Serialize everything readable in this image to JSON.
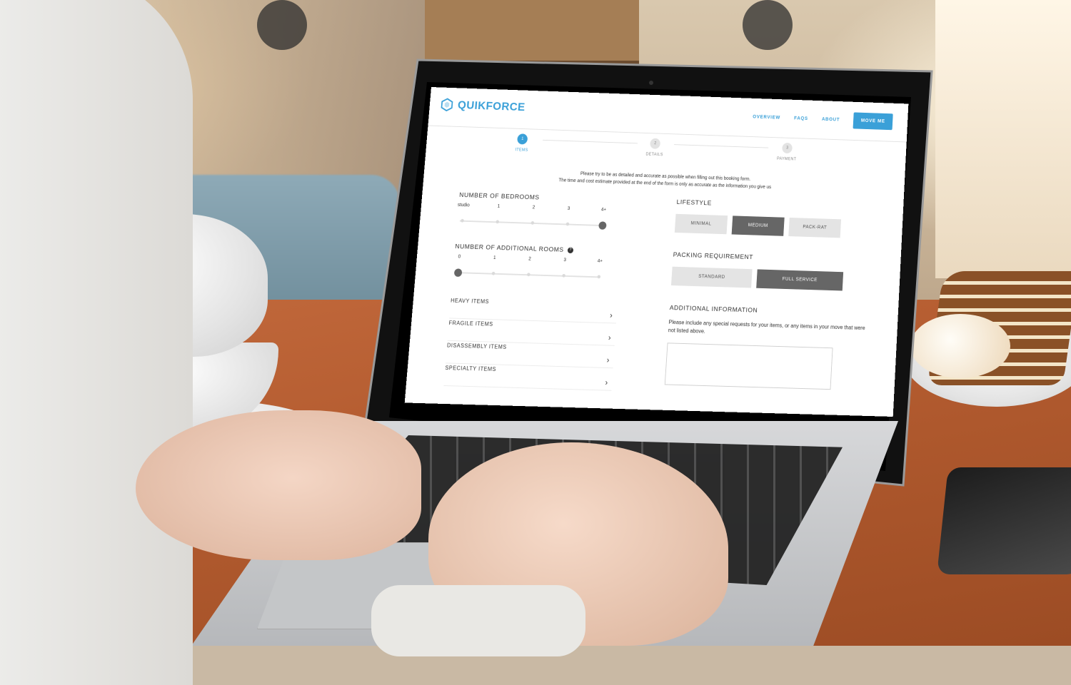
{
  "app": {
    "brand": "QUIKFORCE",
    "brand_color": "#3aa0d8",
    "logo_icon": "hexagon-icon"
  },
  "nav": {
    "links": [
      "OVERVIEW",
      "FAQS",
      "ABOUT"
    ],
    "cta": "MOVE ME"
  },
  "steps": [
    {
      "number": "1",
      "label": "ITEMS",
      "active": true
    },
    {
      "number": "2",
      "label": "DETAILS",
      "active": false
    },
    {
      "number": "3",
      "label": "PAYMENT",
      "active": false
    }
  ],
  "intro": {
    "line1": "Please try to be as detailed and accurate as possible when filling out this booking form.",
    "line2": "The time and cost estimate provided at the end of the form is only as accurate as the information you give us"
  },
  "bedrooms": {
    "title": "NUMBER OF BEDROOMS",
    "ticks": [
      "studio",
      "1",
      "2",
      "3",
      "4+"
    ],
    "selected": "4+"
  },
  "additional_rooms": {
    "title": "NUMBER OF ADDITIONAL ROOMS",
    "help_icon": "question-icon",
    "help_glyph": "?",
    "ticks": [
      "0",
      "1",
      "2",
      "3",
      "4+"
    ],
    "selected": "0"
  },
  "item_categories": [
    {
      "label": "HEAVY ITEMS"
    },
    {
      "label": "FRAGILE ITEMS"
    },
    {
      "label": "DISASSEMBLY ITEMS"
    },
    {
      "label": "SPECIALTY ITEMS"
    }
  ],
  "chevron_glyph": "›",
  "lifestyle": {
    "title": "LIFESTYLE",
    "options": [
      "MINIMAL",
      "MEDIUM",
      "PACK-RAT"
    ],
    "selected": "MEDIUM"
  },
  "packing": {
    "title": "PACKING REQUIREMENT",
    "options": [
      "STANDARD",
      "FULL SERVICE"
    ],
    "selected": "FULL SERVICE"
  },
  "additional_info": {
    "title": "ADDITIONAL INFORMATION",
    "description": "Please include any special requests for your items, or any items in your move that were not listed above.",
    "value": ""
  }
}
